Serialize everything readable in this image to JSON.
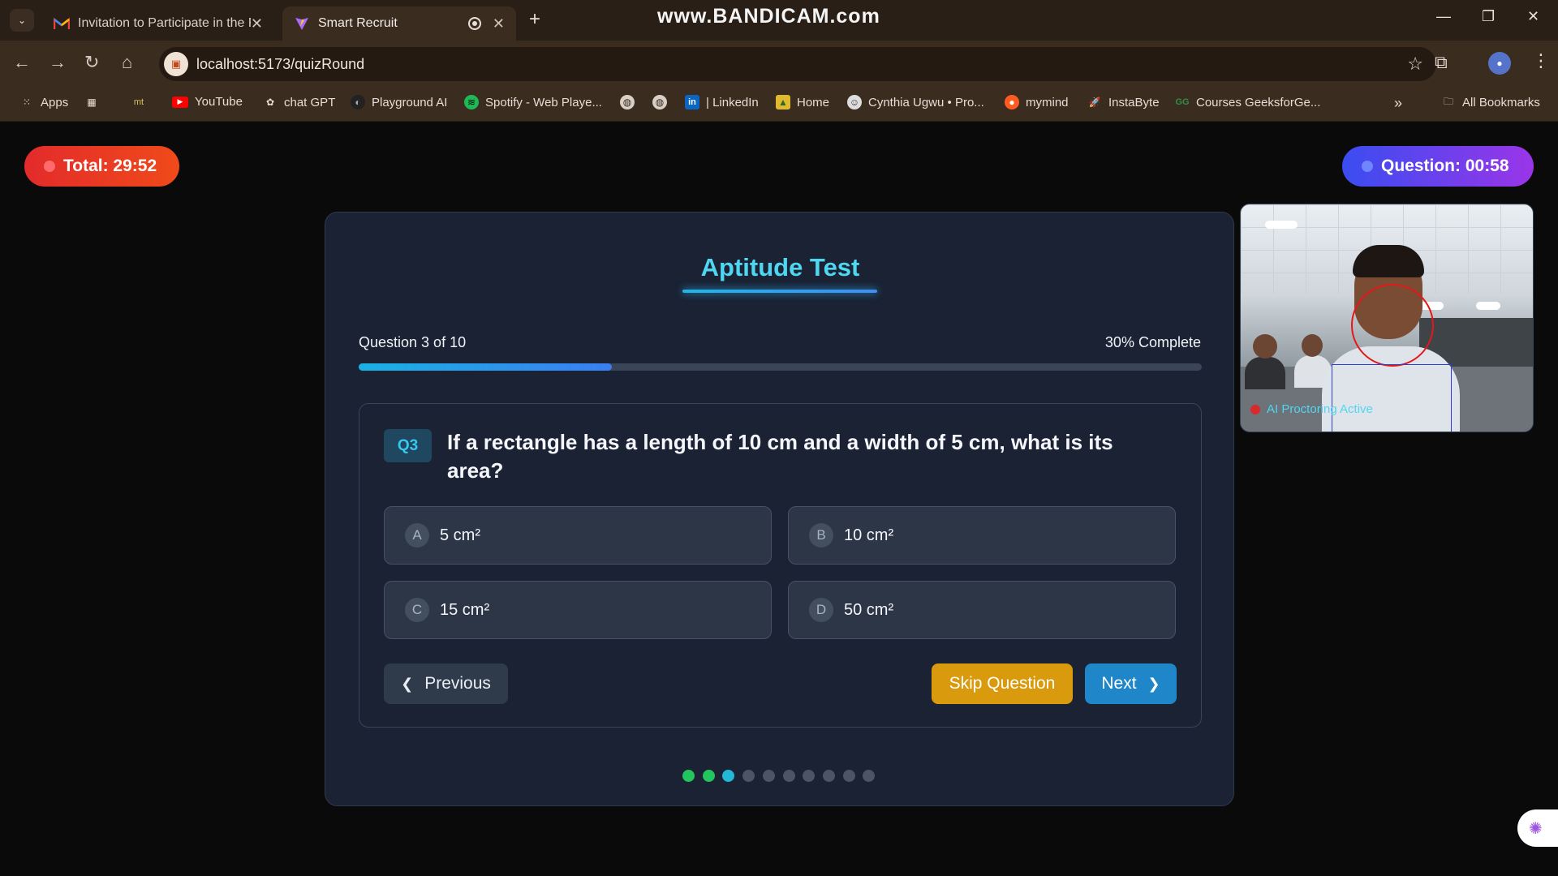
{
  "browser": {
    "tabs": [
      {
        "title": "Invitation to Participate in the R",
        "favicon": "gmail-icon"
      },
      {
        "title": "Smart Recruit",
        "favicon": "vite-icon"
      }
    ],
    "watermark": "www.BANDICAM.com",
    "url": "localhost:5173/quizRound",
    "bookmarks": [
      {
        "label": "Apps",
        "icon": "apps-grid-icon"
      },
      {
        "label": "",
        "icon": "grid-icon"
      },
      {
        "label": "mt",
        "icon": "mt-icon"
      },
      {
        "label": "YouTube",
        "icon": "youtube-icon"
      },
      {
        "label": "chat GPT",
        "icon": "openai-icon"
      },
      {
        "label": "Playground AI",
        "icon": "playground-icon"
      },
      {
        "label": "Spotify - Web Playe...",
        "icon": "spotify-icon"
      },
      {
        "label": "",
        "icon": "globe-icon"
      },
      {
        "label": "",
        "icon": "globe-icon"
      },
      {
        "label": "| LinkedIn",
        "icon": "linkedin-icon"
      },
      {
        "label": "Home",
        "icon": "home-image-icon"
      },
      {
        "label": "Cynthia Ugwu • Pro...",
        "icon": "profile-icon"
      },
      {
        "label": "mymind",
        "icon": "mymind-icon"
      },
      {
        "label": "InstaByte",
        "icon": "rocket-icon"
      },
      {
        "label": "Courses GeeksforGe...",
        "icon": "geeksforgeeks-icon"
      }
    ],
    "all_bookmarks": "All Bookmarks",
    "colors": {
      "chrome_bg": "#2a1f16",
      "toolbar_bg": "#3b2c20"
    }
  },
  "timers": {
    "total": "Total: 29:52",
    "question": "Question: 00:58"
  },
  "quiz": {
    "title": "Aptitude Test",
    "question_count": "Question 3 of 10",
    "percent_label": "30% Complete",
    "progress": 0.3,
    "badge": "Q3",
    "question": "If a rectangle has a length of 10 cm and a width of 5 cm, what is its area?",
    "options": [
      {
        "letter": "A",
        "text": "5 cm²"
      },
      {
        "letter": "B",
        "text": "10 cm²"
      },
      {
        "letter": "C",
        "text": "15 cm²"
      },
      {
        "letter": "D",
        "text": "50 cm²"
      }
    ],
    "buttons": {
      "previous": "Previous",
      "skip": "Skip Question",
      "next": "Next"
    },
    "dots": [
      "answered",
      "answered",
      "current",
      "pending",
      "pending",
      "pending",
      "pending",
      "pending",
      "pending",
      "pending"
    ],
    "colors": {
      "answered": "#22c55e",
      "current": "#22b8d6",
      "pending": "#4b5563",
      "accent": "#4fd6f0"
    }
  },
  "webcam": {
    "status": "AI Proctoring Active"
  }
}
